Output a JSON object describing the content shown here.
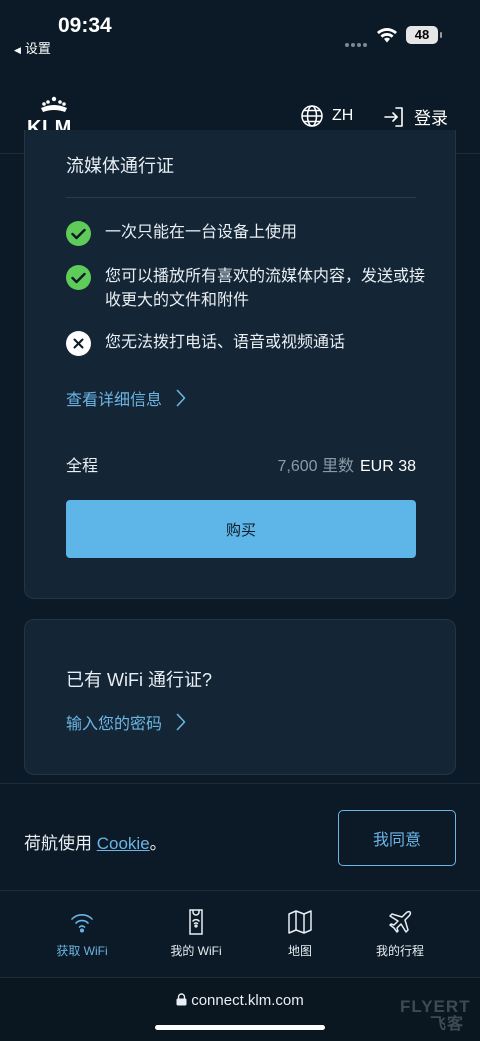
{
  "status_bar": {
    "time": "09:34",
    "back_app": "设置",
    "battery": "48"
  },
  "header": {
    "logo": "KLM",
    "lang": "ZH",
    "login": "登录"
  },
  "pass_card": {
    "title": "流媒体通行证",
    "features": [
      {
        "text": "一次只能在一台设备上使用",
        "included": true
      },
      {
        "text": "您可以播放所有喜欢的流媒体内容，发送或接收更大的文件和附件",
        "included": true
      },
      {
        "text": "您无法拨打电话、语音或视频通话",
        "included": false
      }
    ],
    "details_link": "查看详细信息",
    "price": {
      "label": "全程",
      "miles": "7,600 里数",
      "eur": "EUR 38"
    },
    "buy_button": "购买"
  },
  "code_card": {
    "title": "已有 WiFi 通行证?",
    "link": "输入您的密码"
  },
  "cookie": {
    "text_prefix": "荷航使用 ",
    "link": "Cookie",
    "text_suffix": "。",
    "agree_button": "我同意"
  },
  "tabs": [
    {
      "label": "获取 WiFi",
      "icon": "wifi-icon",
      "active": true
    },
    {
      "label": "我的 WiFi",
      "icon": "pass-icon",
      "active": false
    },
    {
      "label": "地图",
      "icon": "map-icon",
      "active": false
    },
    {
      "label": "我的行程",
      "icon": "plane-icon",
      "active": false
    }
  ],
  "browser": {
    "url": "connect.klm.com"
  },
  "watermark": {
    "line1": "FLYERT",
    "line2": "飞客"
  },
  "colors": {
    "background": "#0b1a26",
    "card": "#142635",
    "accent": "#6cb4e4",
    "button": "#5eb5e8",
    "check": "#5fcb59"
  }
}
